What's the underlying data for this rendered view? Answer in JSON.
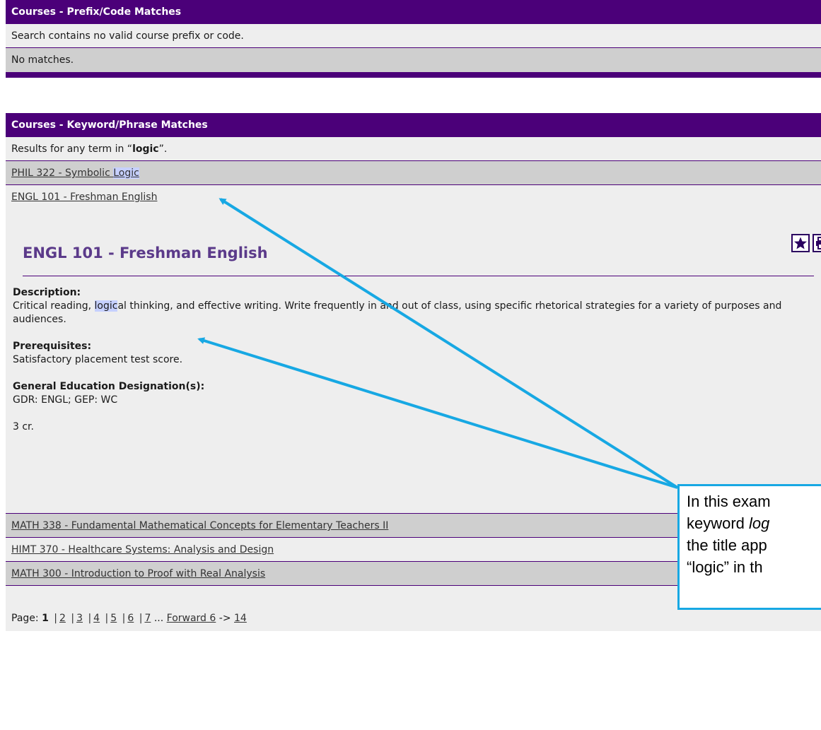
{
  "prefix_panel": {
    "header": "Courses - Prefix/Code Matches",
    "message": "Search contains no valid course prefix or code.",
    "no_matches": "No matches."
  },
  "keyword_panel": {
    "header": "Courses - Keyword/Phrase Matches",
    "results_prefix": "Results for any term in “",
    "results_term": "logic",
    "results_suffix": "”.",
    "items": [
      {
        "before": "PHIL 322 - Symbolic ",
        "highlight": "Logic",
        "after": ""
      },
      {
        "before": "ENGL 101 - Freshman English",
        "highlight": "",
        "after": ""
      }
    ],
    "items_after": [
      "MATH 338 - Fundamental Mathematical Concepts for Elementary Teachers II",
      "HIMT 370 - Healthcare Systems: Analysis and Design",
      "MATH 300 - Introduction to Proof with Real Analysis"
    ]
  },
  "detail": {
    "title": "ENGL 101 - Freshman English",
    "description_label": "Description:",
    "description_before": "Critical reading, ",
    "description_highlight": "logic",
    "description_after": "al thinking, and effective writing. Write frequently in and out of class, using specific rhetorical strategies for a variety of purposes and audiences.",
    "prereq_label": "Prerequisites:",
    "prereq_text": "Satisfactory placement test score.",
    "gened_label": "General Education Designation(s):",
    "gened_text": "GDR: ENGL; GEP: WC",
    "credits": "3 cr.",
    "icons": [
      "star-icon",
      "print-icon"
    ]
  },
  "pager": {
    "label": "Page:",
    "current": "1",
    "pages": [
      "2",
      "3",
      "4",
      "5",
      "6",
      "7"
    ],
    "ellipsis": "...",
    "forward": "Forward 6",
    "arrow": "->",
    "last": "14"
  },
  "callout": {
    "line1": "In this exam",
    "line2_pre": "keyword ",
    "line2_em": "log",
    "line3": "the title app",
    "line4": "“logic” in th"
  },
  "colors": {
    "header_purple": "#4b0079",
    "title_purple": "#5b3a8a",
    "highlight": "#c6d0ff",
    "annotation_blue": "#17a8e3"
  }
}
